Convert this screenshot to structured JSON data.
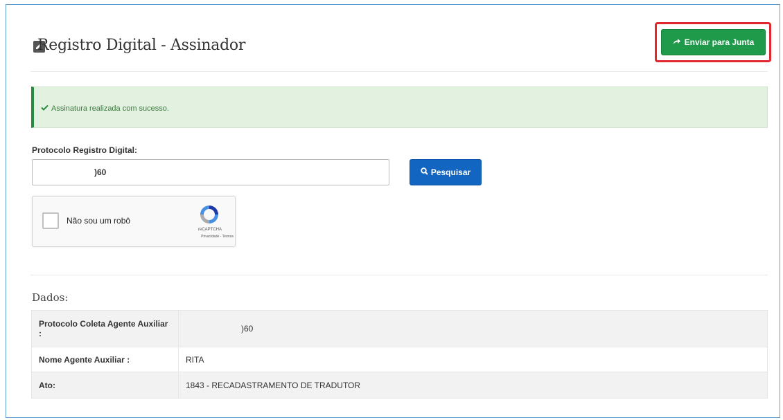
{
  "header": {
    "title": "Registro Digital - Assinador",
    "title_icon": "edit-icon",
    "send_button_label": "Enviar para Junta",
    "send_button_icon": "share-arrow-icon"
  },
  "alert": {
    "icon": "check-icon",
    "message": "Assinatura realizada com sucesso."
  },
  "form": {
    "protocol_label": "Protocolo Registro Digital:",
    "protocol_value": ")60",
    "search_button_label": "Pesquisar",
    "search_icon": "search-icon"
  },
  "recaptcha": {
    "label": "Não sou um robô",
    "brand": "reCAPTCHA",
    "terms": "Privacidade - Termos"
  },
  "dados": {
    "heading": "Dados:",
    "rows": [
      {
        "key": "Protocolo Coleta Agente Auxiliar :",
        "value": ")60"
      },
      {
        "key": "Nome Agente Auxiliar :",
        "value": "RITA"
      },
      {
        "key": "Ato:",
        "value": "1843 - RECADASTRAMENTO DE TRADUTOR"
      }
    ]
  },
  "colors": {
    "success_button": "#1e9a4a",
    "primary_button": "#1265c0",
    "highlight_border": "#e0282e",
    "alert_background": "#e2f1e0"
  }
}
